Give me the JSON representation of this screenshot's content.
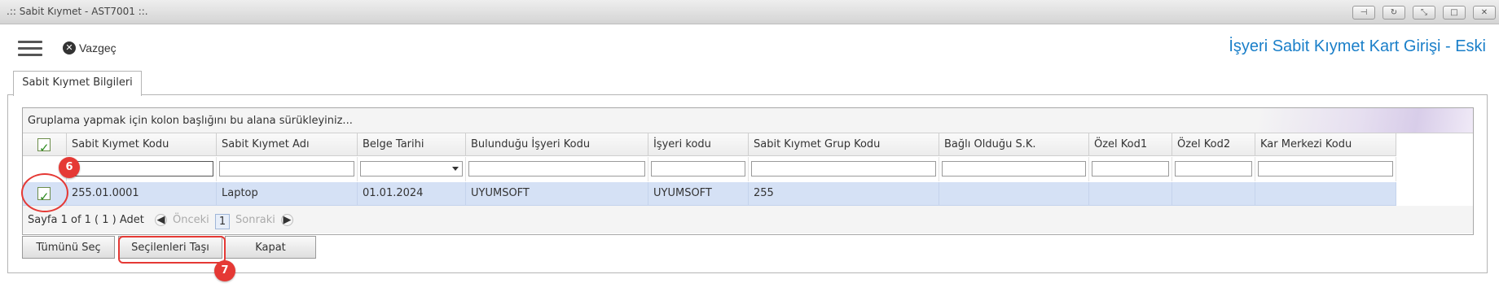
{
  "window": {
    "title": ".:: Sabit Kıymet - AST7001 ::.",
    "controls": [
      {
        "name": "pin-icon",
        "glyph": "⊣"
      },
      {
        "name": "refresh-icon",
        "glyph": "↻"
      },
      {
        "name": "restore-icon",
        "glyph": "⤡"
      },
      {
        "name": "maximize-icon",
        "glyph": "□"
      },
      {
        "name": "close-icon",
        "glyph": "✕"
      }
    ]
  },
  "toolbar": {
    "menu_icon": "hamburger-menu-icon",
    "cancel_label": "Vazgeç",
    "page_title": "İşyeri Sabit Kıymet Kart Girişi - Eski"
  },
  "tab": {
    "label": "Sabit Kıymet Bilgileri"
  },
  "grid": {
    "group_hint": "Gruplama yapmak için kolon başlığını bu alana sürükleyiniz...",
    "columns": [
      "Sabit Kıymet Kodu",
      "Sabit Kıymet Adı",
      "Belge Tarihi",
      "Bulunduğu İşyeri Kodu",
      "İşyeri kodu",
      "Sabit Kıymet Grup Kodu",
      "Bağlı Olduğu S.K.",
      "Özel Kod1",
      "Özel Kod2",
      "Kar Merkezi Kodu"
    ],
    "rows": [
      {
        "selected": true,
        "cells": [
          "255.01.0001",
          "Laptop",
          "01.01.2024",
          "UYUMSOFT",
          "UYUMSOFT",
          "255",
          "",
          "",
          "",
          ""
        ]
      }
    ],
    "pager": {
      "summary": "Sayfa 1 of 1 ( 1 ) Adet",
      "prev_label": "Önceki",
      "current_page": "1",
      "next_label": "Sonraki"
    }
  },
  "buttons": {
    "select_all": "Tümünü Seç",
    "move_selected": "Seçilenleri Taşı",
    "close": "Kapat"
  },
  "annotations": [
    {
      "label": "6"
    },
    {
      "label": "7"
    }
  ],
  "colors": {
    "accent": "#1a7fc9",
    "row_selected": "#d5e1f5",
    "annotation": "#e53935"
  }
}
